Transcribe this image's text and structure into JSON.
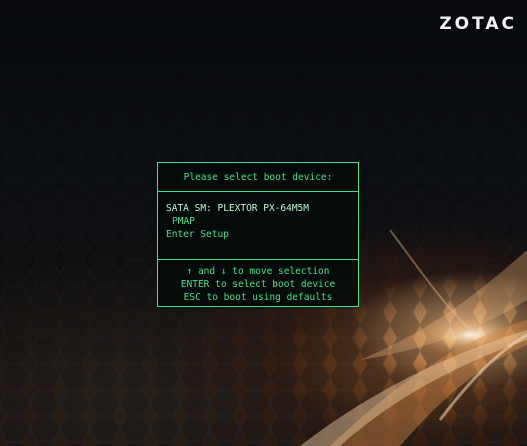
{
  "brand": {
    "logo_text": "ZOTAC"
  },
  "boot_menu": {
    "title": "Please select boot device:",
    "devices": [
      {
        "label": "SATA  SM: PLEXTOR PX-64M5M"
      },
      {
        "label": "PMAP"
      },
      {
        "label": "Enter Setup"
      }
    ],
    "help": [
      "↑ and ↓ to move selection",
      "ENTER to select boot device",
      "ESC to boot using defaults"
    ]
  },
  "colors": {
    "text_green": "#3ee08a",
    "selected_text": "#bff7d2",
    "box_border": "#3ee08a",
    "background_dark": "#050608",
    "flare_orange": "#c8823c"
  }
}
